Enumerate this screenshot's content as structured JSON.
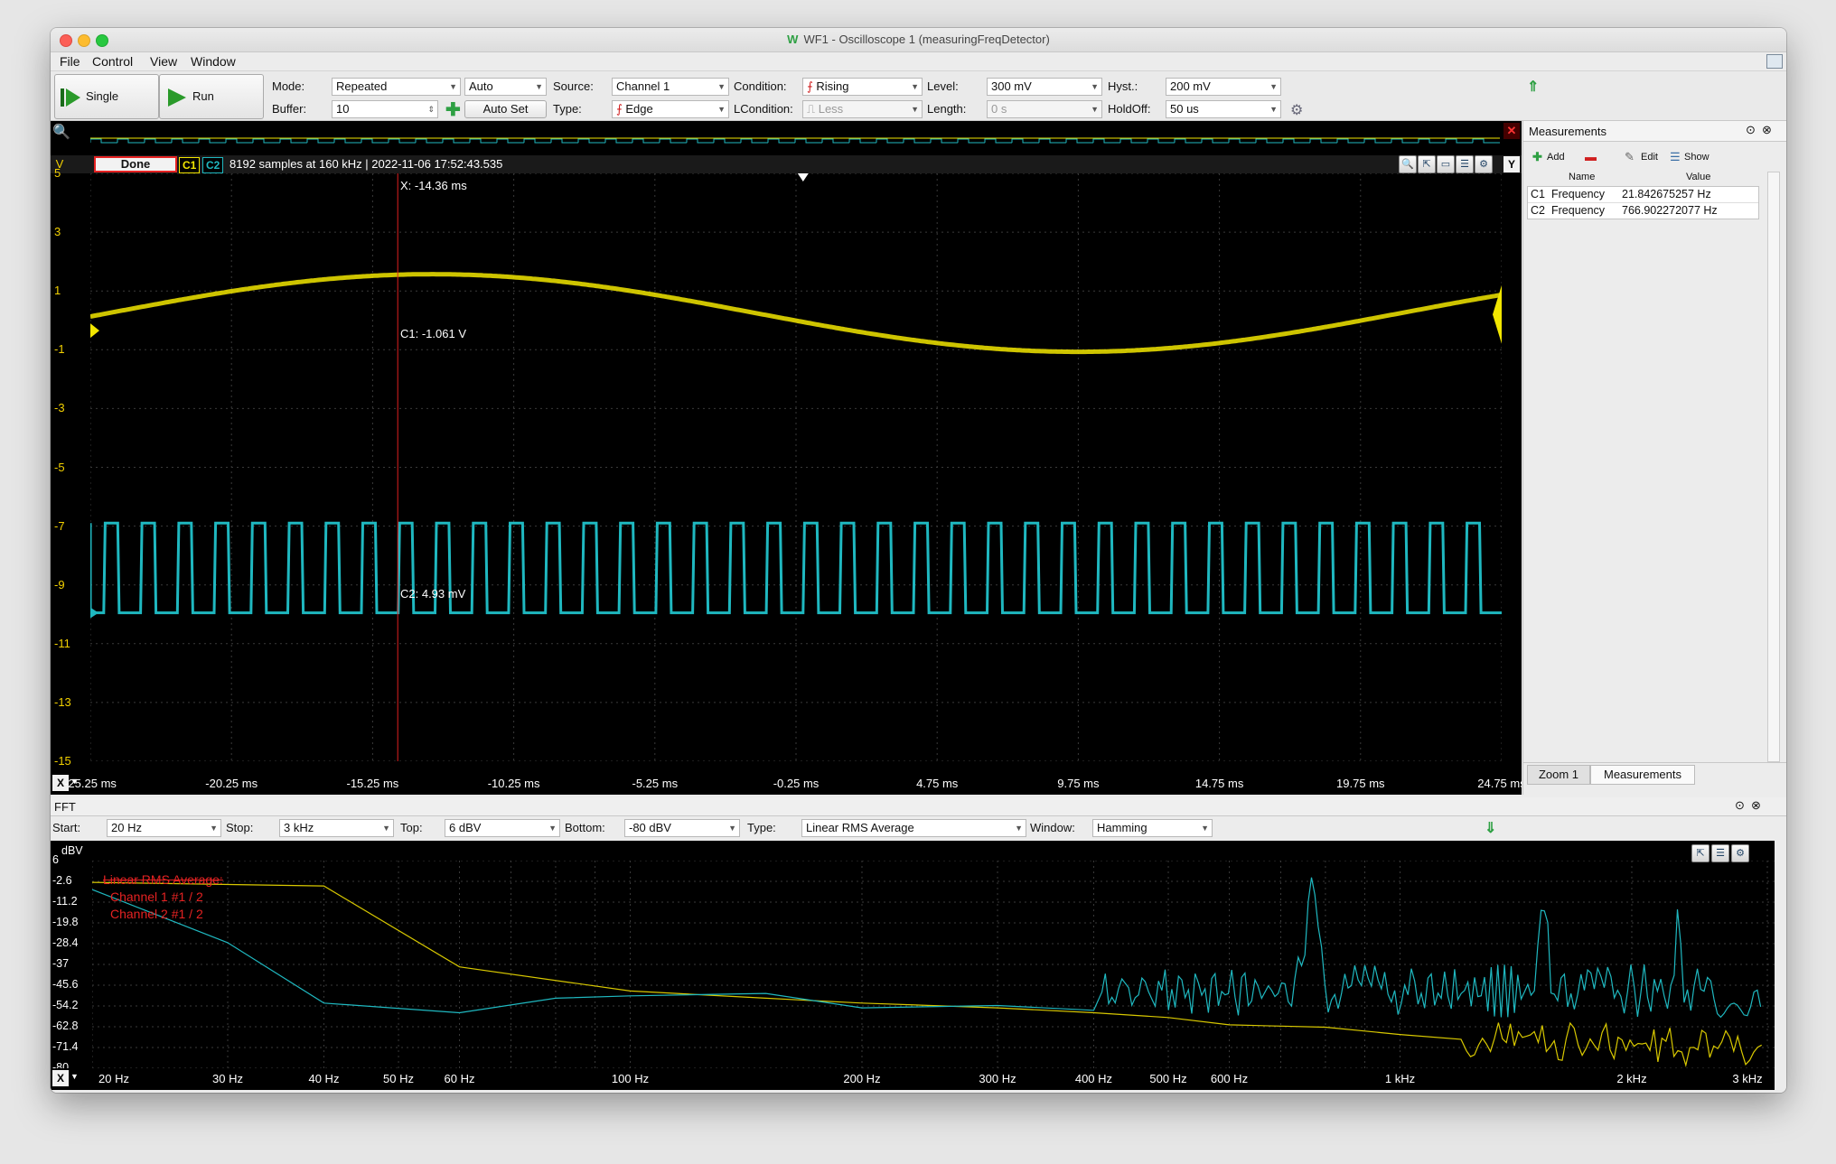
{
  "window": {
    "title": "WF1 - Oscilloscope 1 (measuringFreqDetector)"
  },
  "menu": [
    "File",
    "Control",
    "View",
    "Window"
  ],
  "toolbar": {
    "single_label": "Single",
    "run_label": "Run",
    "mode_label": "Mode:",
    "mode_value": "Repeated",
    "auto_value": "Auto",
    "buffer_label": "Buffer:",
    "buffer_value": "10",
    "autoset_label": "Auto Set",
    "source_label": "Source:",
    "source_value": "Channel 1",
    "type_label": "Type:",
    "type_value": "Edge",
    "condition_label": "Condition:",
    "condition_value": "Rising",
    "lcondition_label": "LCondition:",
    "lcondition_value": "Less",
    "level_label": "Level:",
    "level_value": "300 mV",
    "length_label": "Length:",
    "length_value": "0 s",
    "hyst_label": "Hyst.:",
    "hyst_value": "200 mV",
    "holdoff_label": "HoldOff:",
    "holdoff_value": "50 us"
  },
  "scope": {
    "status_button": "Done",
    "c1_tag": "C1",
    "c2_tag": "C2",
    "status_text": "8192 samples at 160 kHz | 2022-11-06 17:52:43.535",
    "y_unit": "V",
    "y_button": "Y",
    "x_button": "X",
    "y_ticks": [
      "5",
      "3",
      "1",
      "-1",
      "-3",
      "-5",
      "-7",
      "-9",
      "-11",
      "-13",
      "-15"
    ],
    "x_ticks": [
      "-25.25 ms",
      "-20.25 ms",
      "-15.25 ms",
      "-10.25 ms",
      "-5.25 ms",
      "-0.25 ms",
      "4.75 ms",
      "9.75 ms",
      "14.75 ms",
      "19.75 ms",
      "24.75 ms"
    ],
    "cursor_x": "X: -14.36 ms",
    "cursor_c1": "C1: -1.061 V",
    "cursor_c2": "C2: 4.93 mV",
    "colors": {
      "c1": "#f2e600",
      "c2": "#1fb8c0",
      "cursor": "#e02020"
    }
  },
  "measurements": {
    "title": "Measurements",
    "add_label": "Add",
    "edit_label": "Edit",
    "show_label": "Show",
    "col_name": "Name",
    "col_value": "Value",
    "rows": [
      {
        "ch": "C1",
        "name": "Frequency",
        "value": "21.842675257 Hz"
      },
      {
        "ch": "C2",
        "name": "Frequency",
        "value": "766.902272077 Hz"
      }
    ],
    "tab_zoom": "Zoom 1",
    "tab_measurements": "Measurements"
  },
  "fft": {
    "title": "FFT",
    "start_label": "Start:",
    "start_value": "20 Hz",
    "stop_label": "Stop:",
    "stop_value": "3 kHz",
    "top_label": "Top:",
    "top_value": "6 dBV",
    "bottom_label": "Bottom:",
    "bottom_value": "-80 dBV",
    "type_label": "Type:",
    "type_value": "Linear RMS Average",
    "window_label": "Window:",
    "window_value": "Hamming",
    "y_unit": "dBV",
    "y_ticks": [
      "6",
      "-2.6",
      "-11.2",
      "-19.8",
      "-28.4",
      "-37",
      "-45.6",
      "-54.2",
      "-62.8",
      "-71.4",
      "-80"
    ],
    "x_ticks": [
      "20 Hz",
      "30 Hz",
      "40 Hz",
      "50 Hz",
      "60 Hz",
      "100 Hz",
      "200 Hz",
      "300 Hz",
      "400 Hz",
      "500 Hz",
      "600 Hz",
      "1 kHz",
      "2 kHz",
      "3 kHz"
    ],
    "x_button": "X",
    "legend": [
      "Linear RMS Average:",
      "Channel 1 #1 / 2",
      "Channel 2 #1 / 2"
    ]
  }
}
